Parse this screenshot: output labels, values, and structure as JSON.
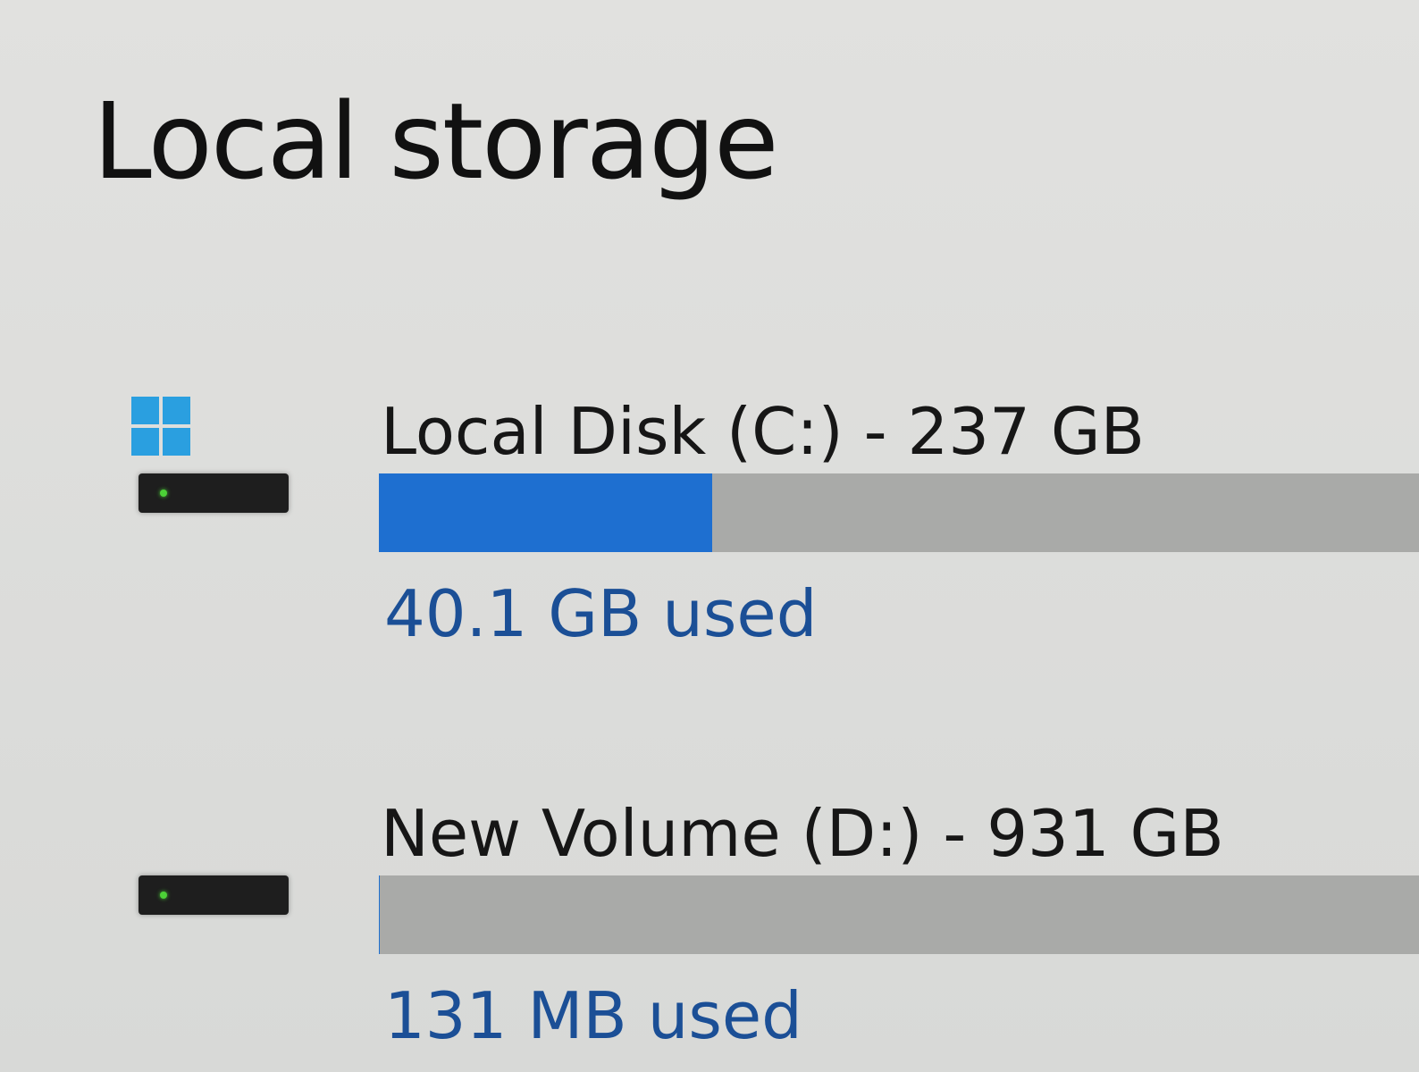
{
  "section": {
    "title": "Local storage"
  },
  "drives": [
    {
      "name": "Local Disk (C:) - 237 GB",
      "used_label": "40.1 GB used",
      "used_fraction": 0.3202,
      "system_drive": true,
      "icon": "windows-logo-icon",
      "accent_color": "#1e6fd0"
    },
    {
      "name": "New Volume (D:) - 931 GB",
      "used_label": "131 MB used",
      "used_fraction": 0.0001,
      "system_drive": false,
      "icon": "hard-drive-icon",
      "accent_color": "#1e6fd0"
    }
  ]
}
